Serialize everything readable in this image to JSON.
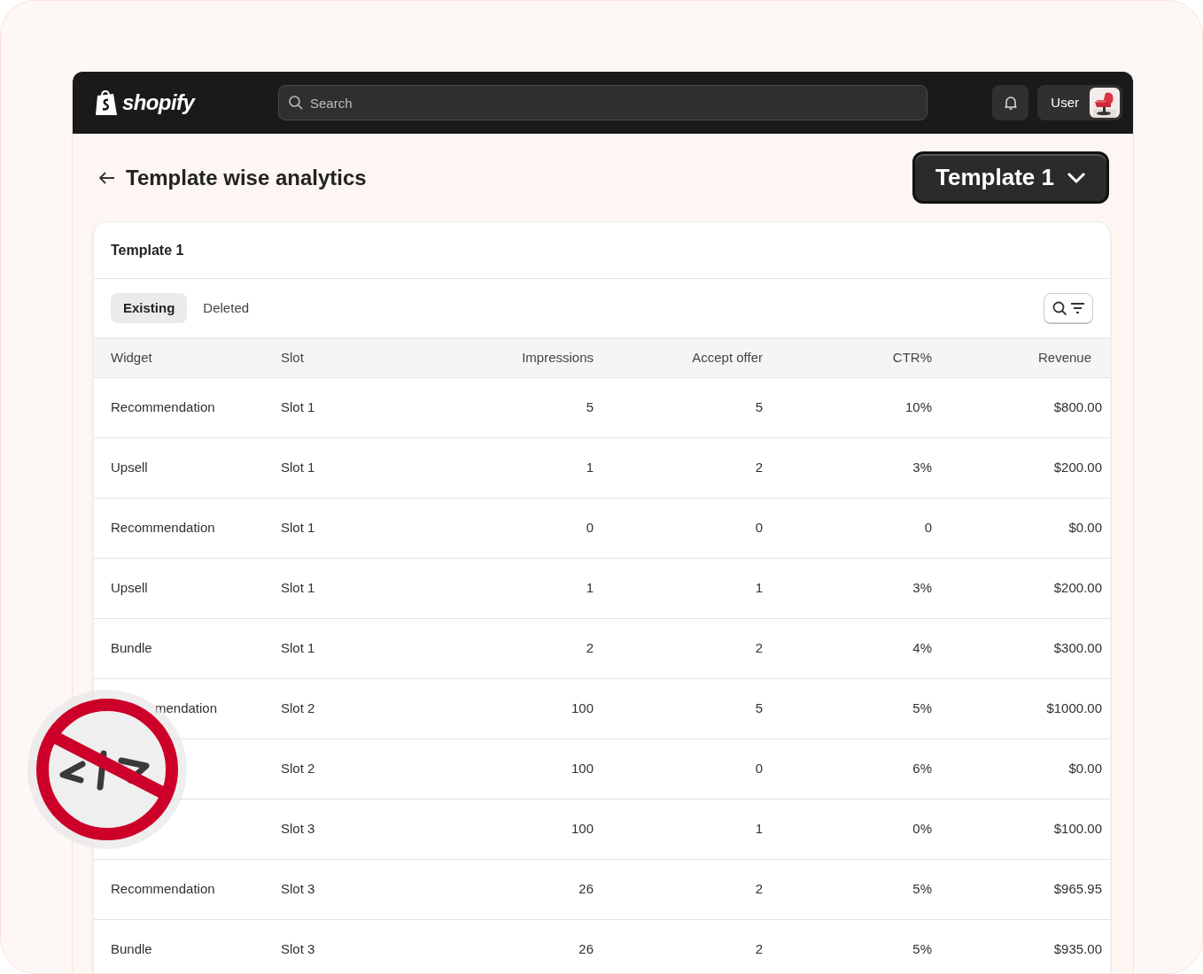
{
  "header": {
    "logo_text": "shopify",
    "search": {
      "placeholder": "Search"
    },
    "user": {
      "label": "User"
    }
  },
  "page": {
    "title": "Template wise analytics",
    "template_select": "Template 1"
  },
  "card": {
    "title": "Template 1",
    "tabs": [
      {
        "label": "Existing",
        "selected": true
      },
      {
        "label": "Deleted",
        "selected": false
      }
    ],
    "table": {
      "columns": [
        "Widget",
        "Slot",
        "Impressions",
        "Accept offer",
        "CTR%",
        "Revenue"
      ],
      "rows": [
        {
          "widget": "Recommendation",
          "slot": "Slot 1",
          "impressions": "5",
          "accept_offer": "5",
          "ctr": "10%",
          "revenue": "$800.00"
        },
        {
          "widget": "Upsell",
          "slot": "Slot 1",
          "impressions": "1",
          "accept_offer": "2",
          "ctr": "3%",
          "revenue": "$200.00"
        },
        {
          "widget": "Recommendation",
          "slot": "Slot 1",
          "impressions": "0",
          "accept_offer": "0",
          "ctr": "0",
          "revenue": "$0.00"
        },
        {
          "widget": "Upsell",
          "slot": "Slot 1",
          "impressions": "1",
          "accept_offer": "1",
          "ctr": "3%",
          "revenue": "$200.00"
        },
        {
          "widget": "Bundle",
          "slot": "Slot 1",
          "impressions": "2",
          "accept_offer": "2",
          "ctr": "4%",
          "revenue": "$300.00"
        },
        {
          "widget": "mendation",
          "partly_hidden": true,
          "slot": "Slot 2",
          "impressions": "100",
          "accept_offer": "5",
          "ctr": "5%",
          "revenue": "$1000.00"
        },
        {
          "slot": "Slot 2",
          "impressions": "100",
          "accept_offer": "0",
          "ctr": "6%",
          "revenue": "$0.00"
        },
        {
          "slot": "Slot 3",
          "impressions": "100",
          "accept_offer": "1",
          "ctr": "0%",
          "revenue": "$100.00"
        },
        {
          "widget": "Recommendation",
          "slot": "Slot 3",
          "impressions": "26",
          "accept_offer": "2",
          "ctr": "5%",
          "revenue": "$965.95"
        },
        {
          "widget": "Bundle",
          "slot": "Slot 3",
          "impressions": "26",
          "accept_offer": "2",
          "ctr": "5%",
          "revenue": "$935.00"
        }
      ]
    }
  },
  "overlay": {
    "kind": "no-code-badge"
  }
}
